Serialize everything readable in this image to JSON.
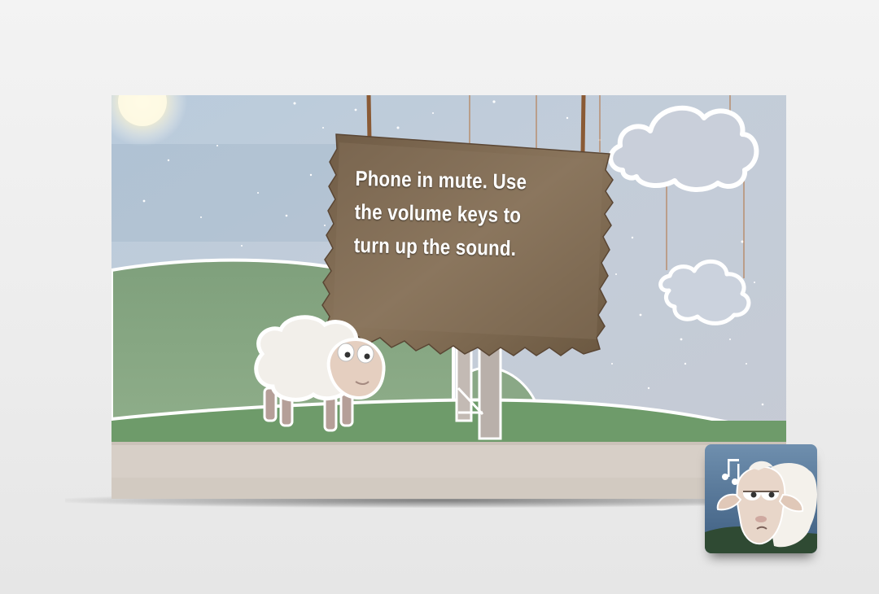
{
  "sign": {
    "message": "Phone in mute. Use\nthe volume keys to\nturn up the sound."
  },
  "icons": {
    "app_icon": "sleepy-sheep-app-icon",
    "notes": "music-note-icon"
  },
  "colors": {
    "sky": "#c5cfdb",
    "grass": "#6f9a6c",
    "sign": "#7e6a52",
    "floor": "#d6cec6"
  }
}
